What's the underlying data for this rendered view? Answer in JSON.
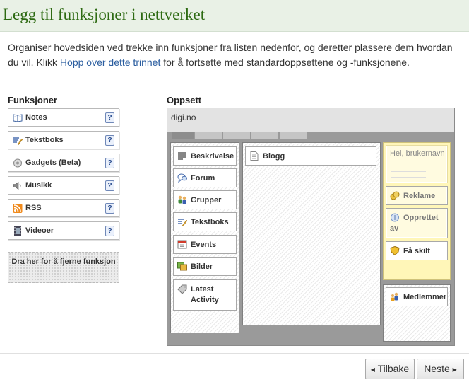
{
  "header": {
    "title": "Legg til funksjoner i nettverket"
  },
  "intro": {
    "part1": "Organiser hovedsiden ved trekke inn funksjoner fra listen nedenfor, og deretter plassere dem hvordan du vil. Klikk ",
    "link": "Hopp over dette trinnet",
    "part2": " for å fortsette med standardoppsettene og -funksjonene."
  },
  "features": {
    "title": "Funksjoner",
    "items": [
      {
        "label": "Notes",
        "icon": "book-icon"
      },
      {
        "label": "Tekstboks",
        "icon": "text-pencil-icon"
      },
      {
        "label": "Gadgets (Beta)",
        "icon": "gadget-icon"
      },
      {
        "label": "Musikk",
        "icon": "speaker-icon"
      },
      {
        "label": "RSS",
        "icon": "rss-icon"
      },
      {
        "label": "Videoer",
        "icon": "film-icon"
      }
    ],
    "help_glyph": "?",
    "dropzone": "Dra her for å fjerne funksjon"
  },
  "layout": {
    "title": "Oppsett",
    "site_name": "digi.no",
    "left_column": [
      {
        "label": "Beskrivelse",
        "icon": "lines-icon"
      },
      {
        "label": "Forum",
        "icon": "speech-icon"
      },
      {
        "label": "Grupper",
        "icon": "group-icon"
      },
      {
        "label": "Tekstboks",
        "icon": "text-pencil-icon"
      },
      {
        "label": "Events",
        "icon": "calendar-icon"
      },
      {
        "label": "Bilder",
        "icon": "photos-icon"
      },
      {
        "label": "Latest Activity",
        "icon": "tag-icon"
      }
    ],
    "center_column": [
      {
        "label": "Blogg",
        "icon": "page-icon"
      }
    ],
    "right_column": {
      "greeting": "Hei, brukernavn",
      "items": [
        {
          "label": "Reklame",
          "icon": "ad-icon"
        },
        {
          "label": "Opprettet av",
          "icon": "info-icon"
        },
        {
          "label": "Få skilt",
          "icon": "badge-icon"
        }
      ],
      "lower_item": {
        "label": "Medlemmer",
        "icon": "members-icon"
      }
    }
  },
  "nav": {
    "back": "Tilbake",
    "next": "Neste"
  },
  "colors": {
    "header_green": "#2d6a12",
    "link_blue": "#2a5d9f",
    "yellow_panel": "#fff6b8"
  }
}
